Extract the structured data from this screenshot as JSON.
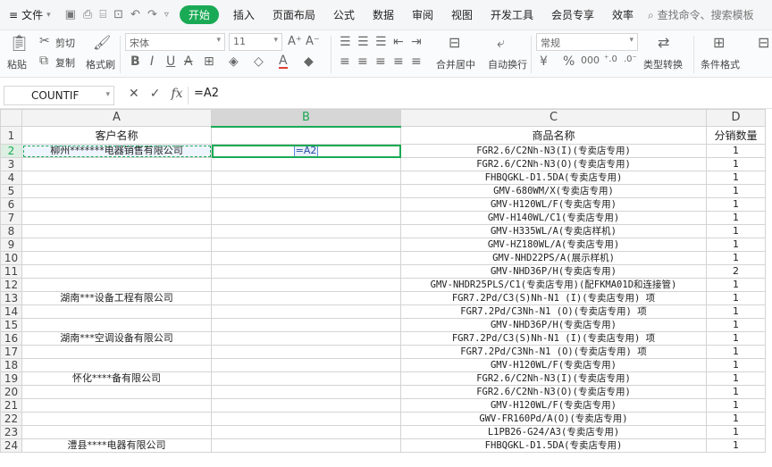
{
  "menubar": {
    "file": "文件",
    "tabs": [
      "开始",
      "插入",
      "页面布局",
      "公式",
      "数据",
      "审阅",
      "视图",
      "开发工具",
      "会员专享",
      "效率"
    ],
    "active_tab": "开始",
    "search": "查找命令、搜索模板"
  },
  "ribbon": {
    "paste": "粘贴",
    "cut": "剪切",
    "copy": "复制",
    "format_painter": "格式刷",
    "font": "宋体",
    "font_size": "11",
    "merge_center": "合并居中",
    "wrap": "自动换行",
    "number_format": "常规",
    "type_convert": "类型转换",
    "cond_format": "条件格式"
  },
  "formula_bar": {
    "name_box": "COUNTIF",
    "fx": "fx",
    "formula": "=A2"
  },
  "columns": [
    "A",
    "B",
    "C",
    "D"
  ],
  "selected_column": "B",
  "header_row": {
    "row": "1",
    "A": "客户名称",
    "B": "",
    "C": "商品名称",
    "D": "分销数量"
  },
  "rows": [
    {
      "row": "2",
      "A": "柳州*******电器销售有限公司",
      "B": "=A2",
      "C": "FGR2.6/C2Nh-N3(I)(专卖店专用)",
      "D": "1"
    },
    {
      "row": "3",
      "A": "",
      "B": "",
      "C": "FGR2.6/C2Nh-N3(O)(专卖店专用)",
      "D": "1"
    },
    {
      "row": "4",
      "A": "",
      "B": "",
      "C": "FHBQGKL-D1.5DA(专卖店专用)",
      "D": "1"
    },
    {
      "row": "5",
      "A": "",
      "B": "",
      "C": "GMV-680WM/X(专卖店专用)",
      "D": "1"
    },
    {
      "row": "6",
      "A": "",
      "B": "",
      "C": "GMV-H120WL/F(专卖店专用)",
      "D": "1"
    },
    {
      "row": "7",
      "A": "",
      "B": "",
      "C": "GMV-H140WL/C1(专卖店专用)",
      "D": "1"
    },
    {
      "row": "8",
      "A": "",
      "B": "",
      "C": "GMV-H335WL/A(专卖店样机)",
      "D": "1"
    },
    {
      "row": "9",
      "A": "",
      "B": "",
      "C": "GMV-HZ180WL/A(专卖店专用)",
      "D": "1"
    },
    {
      "row": "10",
      "A": "",
      "B": "",
      "C": "GMV-NHD22PS/A(展示样机)",
      "D": "1"
    },
    {
      "row": "11",
      "A": "",
      "B": "",
      "C": "GMV-NHD36P/H(专卖店专用)",
      "D": "2"
    },
    {
      "row": "12",
      "A": "",
      "B": "",
      "C": "GMV-NHDR25PLS/C1(专卖店专用)(配FKMA01D和连接管)",
      "D": "1"
    },
    {
      "row": "13",
      "A": "湖南***设备工程有限公司",
      "B": "",
      "C": "FGR7.2Pd/C3(S)Nh-N1 (I)(专卖店专用) 项",
      "D": "1"
    },
    {
      "row": "14",
      "A": "",
      "B": "",
      "C": "FGR7.2Pd/C3Nh-N1 (O)(专卖店专用) 项",
      "D": "1"
    },
    {
      "row": "15",
      "A": "",
      "B": "",
      "C": "GMV-NHD36P/H(专卖店专用)",
      "D": "1"
    },
    {
      "row": "16",
      "A": "湖南***空调设备有限公司",
      "B": "",
      "C": "FGR7.2Pd/C3(S)Nh-N1 (I)(专卖店专用) 项",
      "D": "1"
    },
    {
      "row": "17",
      "A": "",
      "B": "",
      "C": "FGR7.2Pd/C3Nh-N1 (O)(专卖店专用) 项",
      "D": "1"
    },
    {
      "row": "18",
      "A": "",
      "B": "",
      "C": "GMV-H120WL/F(专卖店专用)",
      "D": "1"
    },
    {
      "row": "19",
      "A": "怀化****备有限公司",
      "B": "",
      "C": "FGR2.6/C2Nh-N3(I)(专卖店专用)",
      "D": "1"
    },
    {
      "row": "20",
      "A": "",
      "B": "",
      "C": "FGR2.6/C2Nh-N3(O)(专卖店专用)",
      "D": "1"
    },
    {
      "row": "21",
      "A": "",
      "B": "",
      "C": "GMV-H120WL/F(专卖店专用)",
      "D": "1"
    },
    {
      "row": "22",
      "A": "",
      "B": "",
      "C": "GWV-FR160Pd/A(O)(专卖店专用)",
      "D": "1"
    },
    {
      "row": "23",
      "A": "",
      "B": "",
      "C": "L1PB26-G24/A3(专卖店专用)",
      "D": "1"
    },
    {
      "row": "24",
      "A": "澧县****电器有限公司",
      "B": "",
      "C": "FHBQGKL-D1.5DA(专卖店专用)",
      "D": "1"
    }
  ],
  "colors": {
    "accent": "#1aaa55",
    "reference": "#5b8ed6"
  }
}
